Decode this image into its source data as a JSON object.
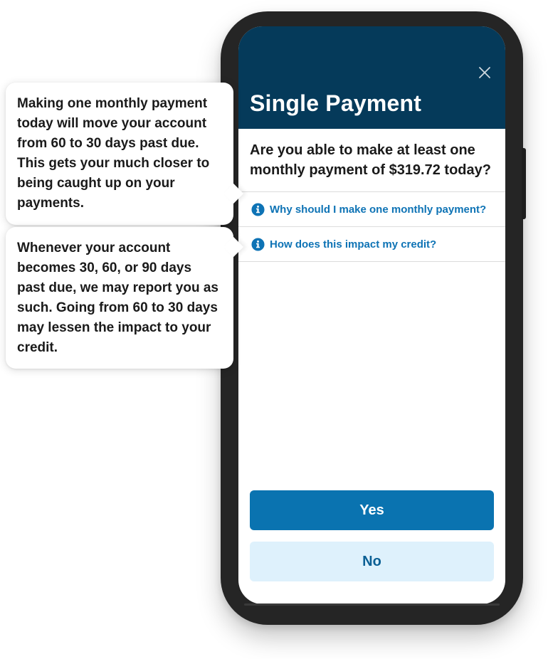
{
  "header": {
    "title": "Single Payment",
    "close_icon": "close-icon"
  },
  "question": "Are you able to make at least one monthly payment of $319.72 today?",
  "info_links": [
    {
      "label": "Why should I make one monthly payment?",
      "icon": "info-icon"
    },
    {
      "label": "How does this impact my credit?",
      "icon": "info-icon"
    }
  ],
  "actions": {
    "yes_label": "Yes",
    "no_label": "No"
  },
  "callouts": [
    {
      "text": "Making one monthly payment today will move your account from 60 to 30 days past due. This gets your much closer to being caught up on your payments."
    },
    {
      "text": "Whenever your account becomes 30, 60, or 90 days past due, we may report you as such. Going from 60 to 30 days may lessen the impact to your credit."
    }
  ],
  "colors": {
    "header_bg": "#053a5a",
    "primary": "#0a73b0",
    "secondary_bg": "#def1fc",
    "link": "#0e73b5",
    "phone_frame": "#252525"
  }
}
